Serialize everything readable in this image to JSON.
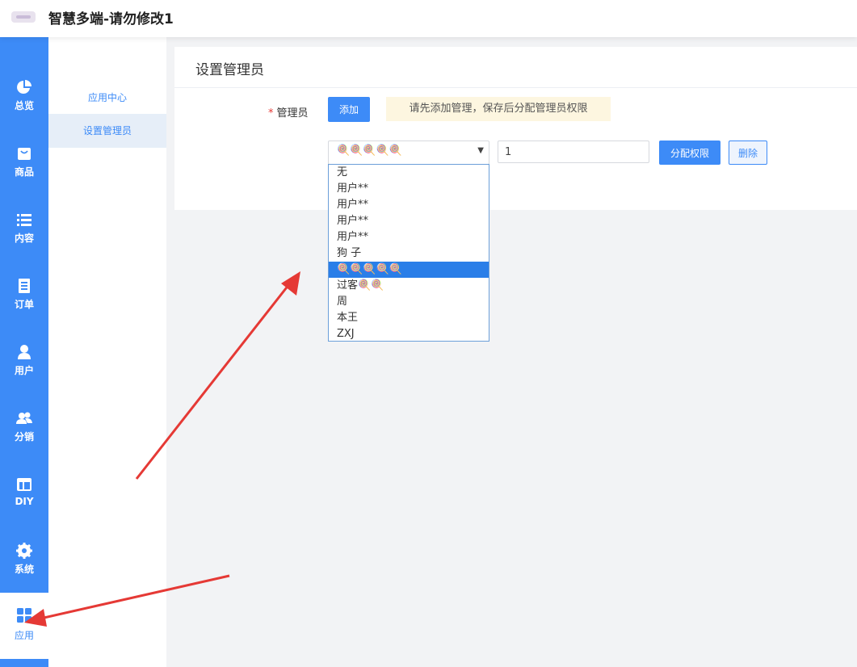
{
  "header": {
    "title": "智慧多端-请勿修改1"
  },
  "nav": {
    "items": [
      {
        "label": "总览",
        "icon": "pie-chart-icon"
      },
      {
        "label": "商品",
        "icon": "shopping-bag-icon"
      },
      {
        "label": "内容",
        "icon": "list-icon"
      },
      {
        "label": "订单",
        "icon": "order-icon"
      },
      {
        "label": "用户",
        "icon": "user-icon"
      },
      {
        "label": "分销",
        "icon": "users-icon"
      },
      {
        "label": "DIY",
        "icon": "layout-icon"
      },
      {
        "label": "系统",
        "icon": "gear-icon"
      },
      {
        "label": "应用",
        "icon": "apps-grid-icon"
      }
    ],
    "active": "应用"
  },
  "subnav": {
    "items": [
      {
        "label": "应用中心"
      },
      {
        "label": "设置管理员"
      }
    ],
    "active": "设置管理员"
  },
  "panel": {
    "title": "设置管理员",
    "field_label": "管理员",
    "required_mark": "*",
    "add_button": "添加",
    "tip": "请先添加管理，保存后分配管理员权限",
    "select_value": "🍭🍭🍭🍭🍭",
    "input_value": "1",
    "assign_button": "分配权限",
    "delete_button": "删除"
  },
  "dropdown": {
    "options": [
      "无",
      "用户**",
      "用户**",
      "用户**",
      "用户**",
      "狗 子",
      "🍭🍭🍭🍭🍭",
      "过客🍭🍭",
      "周",
      "本王",
      "ZXJ"
    ],
    "selected_index": 6
  },
  "colors": {
    "primary": "#3d8bf7",
    "selected_option": "#2a7ee8",
    "tip_bg": "#fdf6e0",
    "arrow": "#e53935"
  }
}
